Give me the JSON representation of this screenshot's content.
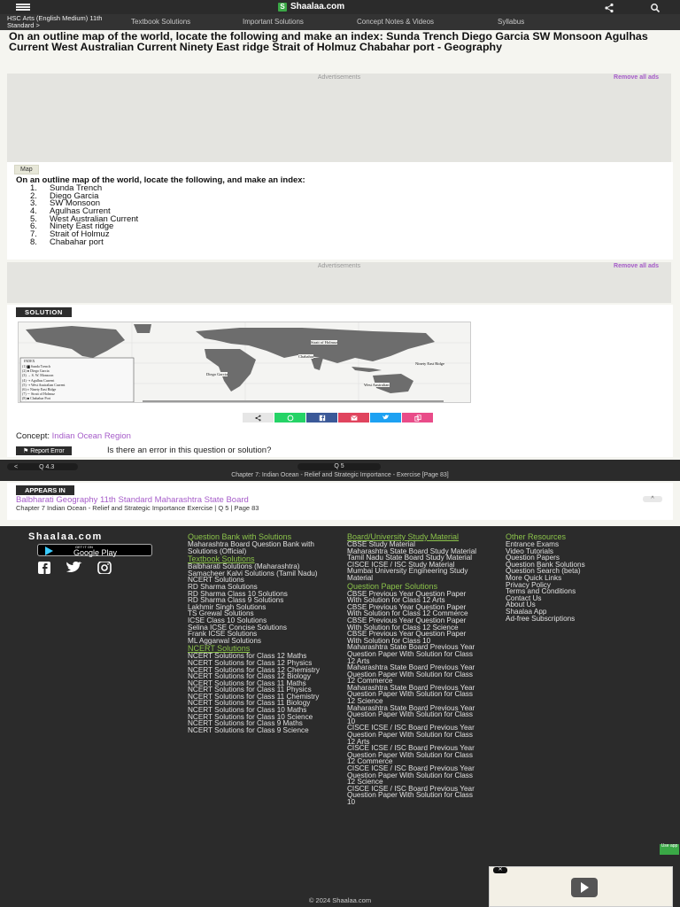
{
  "topbar": {
    "logo_badge": "S",
    "logo_text": "Shaalaa.com"
  },
  "navbar": {
    "breadcrumb": "HSC Arts (English Medium) 11th Standard",
    "breadcrumb_arrow": ">",
    "links": [
      "Textbook Solutions",
      "Important Solutions",
      "Concept Notes & Videos",
      "Syllabus"
    ]
  },
  "question": {
    "title": "On an outline map of the world, locate the following and make an index: Sunda Trench Diego Garcia SW Monsoon Agulhas Current West Australian Current Ninety East ridge Strait of Holmuz Chabahar port - Geography",
    "tag": "Map",
    "text": "On an outline map of the world, locate the following, and make an index:",
    "items": [
      {
        "num": "1.",
        "label": "Sunda Trench"
      },
      {
        "num": "2.",
        "label": "Diego Garcia"
      },
      {
        "num": "3.",
        "label": "SW Monsoon"
      },
      {
        "num": "4.",
        "label": "Agulhas Current"
      },
      {
        "num": "5.",
        "label": "West Australian Current"
      },
      {
        "num": "6.",
        "label": "Ninety East ridge"
      },
      {
        "num": "7.",
        "label": "Strait of Holmuz"
      },
      {
        "num": "8.",
        "label": "Chabahar port"
      }
    ]
  },
  "ads": {
    "label": "Advertisements",
    "remove": "Remove all ads"
  },
  "solution": {
    "badge": "SOLUTION",
    "map_index": [
      {
        "num": "(1)",
        "label": "Sunda Trench"
      },
      {
        "num": "(2)",
        "label": "Diego Garcia"
      },
      {
        "num": "(3)",
        "label": "S. W. Monsoon"
      },
      {
        "num": "(4)",
        "label": "Agulhas Current"
      },
      {
        "num": "(5)",
        "label": "West Australian Current"
      },
      {
        "num": "(6)",
        "label": "Ninety East Ridge"
      },
      {
        "num": "(7)",
        "label": "Strait of Holmuz"
      },
      {
        "num": "(8)",
        "label": "Chabahar Port"
      }
    ],
    "map_labels": {
      "index": "INDEX",
      "strait": "Strait of Holmuz",
      "ninety": "Ninety East Ridge",
      "diego": "Diego Garcia",
      "west": "West Australian",
      "chabahar": "Chabahar"
    }
  },
  "concept": {
    "label": "Concept:",
    "link": "Indian Ocean Region"
  },
  "report": {
    "button": "⚑ Report Error",
    "question": "Is there an error in this question or solution?"
  },
  "chapter_nav": {
    "prev_arrow": "<",
    "prev": "Q 4.3",
    "next": "Q 5",
    "chapter": "Chapter 7: Indian Ocean - Relief and Strategic Importance - Exercise [Page 83]"
  },
  "appears_in": {
    "badge": "APPEARS IN",
    "link": "Balbharati Geography 11th Standard Maharashtra State Board",
    "sub": "Chapter 7 Indian Ocean - Relief and Strategic Importance Exercise | Q 5 | Page 83",
    "chevron": "^"
  },
  "footer": {
    "brand": "Shaalaa.com",
    "gplay_small": "GET IT ON",
    "gplay_big": "Google Play",
    "col1": {
      "h1": "Question Bank with Solutions",
      "items1": [
        "Maharashtra Board Question Bank with Solutions (Official)"
      ],
      "h2": "Textbook Solutions",
      "items2": [
        "Balbharati Solutions (Maharashtra)",
        "Samacheer Kalvi Solutions (Tamil Nadu)",
        "NCERT Solutions",
        "RD Sharma Solutions",
        "RD Sharma Class 10 Solutions",
        "RD Sharma Class 9 Solutions",
        "Lakhmir Singh Solutions",
        "TS Grewal Solutions",
        "ICSE Class 10 Solutions",
        "Selina ICSE Concise Solutions",
        "Frank ICSE Solutions",
        "ML Aggarwal Solutions"
      ],
      "h3": "NCERT Solutions",
      "items3": [
        "NCERT Solutions for Class 12 Maths",
        "NCERT Solutions for Class 12 Physics",
        "NCERT Solutions for Class 12 Chemistry",
        "NCERT Solutions for Class 12 Biology",
        "NCERT Solutions for Class 11 Maths",
        "NCERT Solutions for Class 11 Physics",
        "NCERT Solutions for Class 11 Chemistry",
        "NCERT Solutions for Class 11 Biology",
        "NCERT Solutions for Class 10 Maths",
        "NCERT Solutions for Class 10 Science",
        "NCERT Solutions for Class 9 Maths",
        "NCERT Solutions for Class 9 Science"
      ]
    },
    "col2": {
      "h1": "Board/University Study Material",
      "items1": [
        "CBSE Study Material",
        "Maharashtra State Board Study Material",
        "Tamil Nadu State Board Study Material",
        "CISCE ICSE / ISC Study Material",
        "Mumbai University Engineering Study Material"
      ],
      "h2": "Question Paper Solutions",
      "items2": [
        "CBSE Previous Year Question Paper With Solution for Class 12 Arts",
        "CBSE Previous Year Question Paper With Solution for Class 12 Commerce",
        "CBSE Previous Year Question Paper With Solution for Class 12 Science",
        "CBSE Previous Year Question Paper With Solution for Class 10",
        "Maharashtra State Board Previous Year Question Paper With Solution for Class 12 Arts",
        "Maharashtra State Board Previous Year Question Paper With Solution for Class 12 Commerce",
        "Maharashtra State Board Previous Year Question Paper With Solution for Class 12 Science",
        "Maharashtra State Board Previous Year Question Paper With Solution for Class 10",
        "CISCE ICSE / ISC Board Previous Year Question Paper With Solution for Class 12 Arts",
        "CISCE ICSE / ISC Board Previous Year Question Paper With Solution for Class 12 Commerce",
        "CISCE ICSE / ISC Board Previous Year Question Paper With Solution for Class 12 Science",
        "CISCE ICSE / ISC Board Previous Year Question Paper With Solution for Class 10"
      ]
    },
    "col3": {
      "h1": "Other Resources",
      "items1": [
        "Entrance Exams",
        "Video Tutorials",
        "Question Papers",
        "Question Bank Solutions",
        "Question Search (beta)",
        "More Quick Links",
        "Privacy Policy",
        "Terms and Conditions",
        "Contact Us",
        "About Us",
        "Shaalaa App",
        "Ad-free Subscriptions"
      ]
    },
    "use_app": "Use app",
    "video_close": "✕",
    "copyright": "© 2024 Shaalaa.com"
  }
}
